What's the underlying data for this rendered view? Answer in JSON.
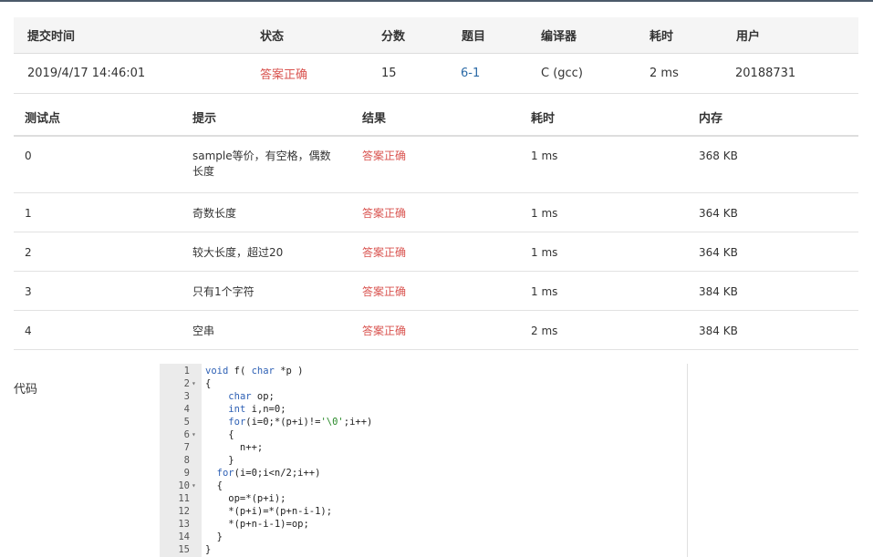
{
  "summary": {
    "headers": [
      "提交时间",
      "状态",
      "分数",
      "题目",
      "编译器",
      "耗时",
      "用户"
    ],
    "row": {
      "submit_time": "2019/4/17 14:46:01",
      "status": "答案正确",
      "score": "15",
      "problem": "6-1",
      "compiler": "C (gcc)",
      "time": "2 ms",
      "user": "20188731"
    },
    "status_color": "#d9534f",
    "link_color": "#2b6aa6"
  },
  "testcases": {
    "headers": [
      "测试点",
      "提示",
      "结果",
      "耗时",
      "内存"
    ],
    "rows": [
      {
        "id": "0",
        "hint": "sample等价，有空格，偶数长度",
        "result": "答案正确",
        "time": "1 ms",
        "memory": "368 KB"
      },
      {
        "id": "1",
        "hint": "奇数长度",
        "result": "答案正确",
        "time": "1 ms",
        "memory": "364 KB"
      },
      {
        "id": "2",
        "hint": "较大长度，超过20",
        "result": "答案正确",
        "time": "1 ms",
        "memory": "364 KB"
      },
      {
        "id": "3",
        "hint": "只有1个字符",
        "result": "答案正确",
        "time": "1 ms",
        "memory": "384 KB"
      },
      {
        "id": "4",
        "hint": "空串",
        "result": "答案正确",
        "time": "2 ms",
        "memory": "384 KB"
      }
    ]
  },
  "code": {
    "label": "代码",
    "lines": [
      "void f( char *p )",
      "{",
      "    char op;",
      "    int i,n=0;",
      "    for(i=0;*(p+i)!='\\0';i++)",
      "    {",
      "      n++;",
      "    }",
      "  for(i=0;i<n/2;i++)",
      "  {",
      "    op=*(p+i);",
      "    *(p+i)=*(p+n-i-1);",
      "    *(p+n-i-1)=op;",
      "  }",
      "}"
    ],
    "foldable_lines": [
      2,
      6,
      10
    ]
  }
}
